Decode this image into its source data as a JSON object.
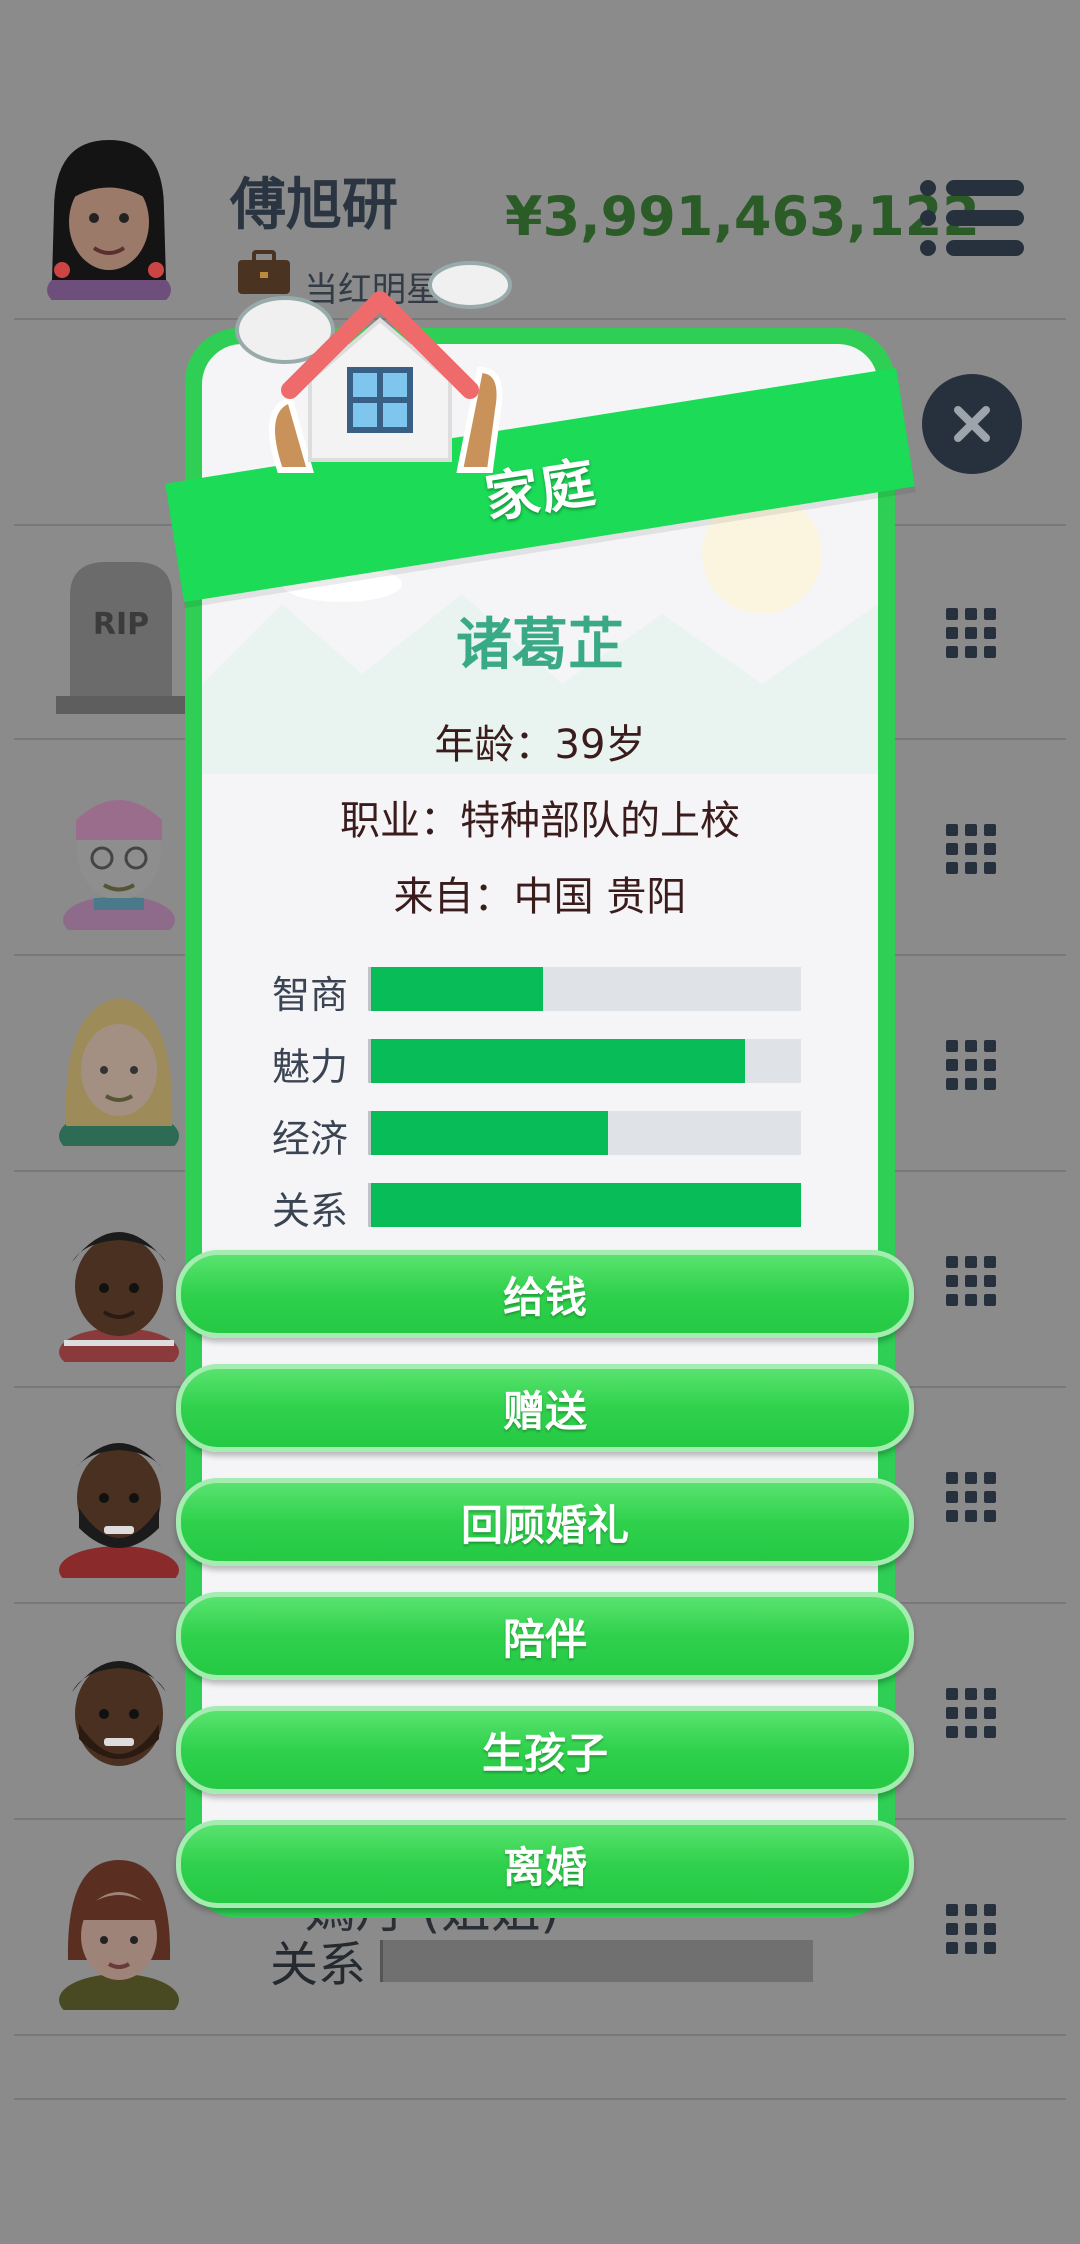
{
  "header": {
    "player_name": "傅旭研",
    "job": "当红明星",
    "money": "¥3,991,463,122"
  },
  "background_rows": {
    "partial_name": "嫣丹 (姐姐)",
    "relation_label": "关系"
  },
  "modal": {
    "title": "家庭",
    "person_name": "诸葛芷",
    "age": "年龄：39岁",
    "job": "职业：特种部队的上校",
    "origin": "来自：中国 贵阳",
    "stats": [
      {
        "label": "智商",
        "value": 0.4
      },
      {
        "label": "魅力",
        "value": 0.87
      },
      {
        "label": "经济",
        "value": 0.55
      },
      {
        "label": "关系",
        "value": 1.0
      }
    ],
    "actions": [
      "给钱",
      "赠送",
      "回顾婚礼",
      "陪伴",
      "生孩子",
      "离婚"
    ]
  },
  "colors": {
    "accent_green": "#1bdb57",
    "stat_fill": "#08bc58",
    "name_teal": "#3aa985",
    "money_green": "#2b5b27"
  }
}
